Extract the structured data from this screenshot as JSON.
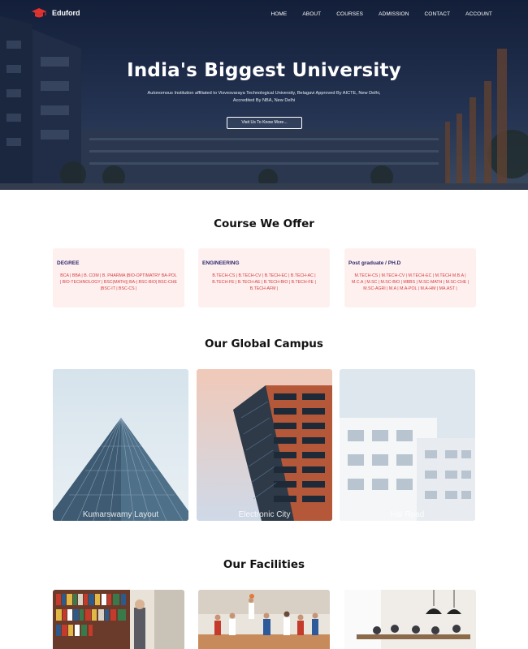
{
  "brand": {
    "name": "Eduford"
  },
  "nav": {
    "items": [
      "HOME",
      "ABOUT",
      "COURSES",
      "ADMISSION",
      "CONTACT",
      "ACCOUNT"
    ]
  },
  "hero": {
    "title": "India's Biggest University",
    "subtitle_line1": "Autonomous Institution affiliated to Visvesvaraya Technological University, Belagavi Approved By AICTE, New Delhi,",
    "subtitle_line2": "Accredited By NBA, New Delhi",
    "button": "Visit Us To Know More..."
  },
  "courses": {
    "title": "Course We Offer",
    "cards": [
      {
        "heading": "DEGREE",
        "text": "BCA | BBA | B. COM | B. PHARMA |BIO-OPTIMATRY BA-POL | BIO-TECHNOLOGY | BSC(MATH)| BA-| BSC-BIO| BSC-CHE |BSC-IT | BSC-CS |"
      },
      {
        "heading": "ENGINEERING",
        "text": "B.TECH-CS | B.TECH-CV | B.TECH-EC | B.TECH-AC | B.TECH-FE | B.TECH-AE | B.TECH-BIO | B.TECH-FE | B.TECH-AFM |"
      },
      {
        "heading": "Post graduate / PH.D",
        "text": "M.TECH-CS | M.TECH-CV | M.TECH-EC | M.TECH M.B.A | M.C.A | M.SC | M.SC-BIO | MBBS | M.SC-MATH | M.SC-CHE | M.SC-AGRI | M.A | M.A-POL | M.A-HM | MA.AST |"
      }
    ]
  },
  "campus": {
    "title": "Our Global Campus",
    "cards": [
      {
        "label": "Kumarswamy Layout"
      },
      {
        "label": "Electronic City"
      },
      {
        "label": "Hal Road"
      }
    ]
  },
  "facilities": {
    "title": "Our Facilities"
  },
  "colors": {
    "accent": "#d33b3b",
    "card_bg": "#fff0f0",
    "heading_blue": "#2a2a6a"
  }
}
